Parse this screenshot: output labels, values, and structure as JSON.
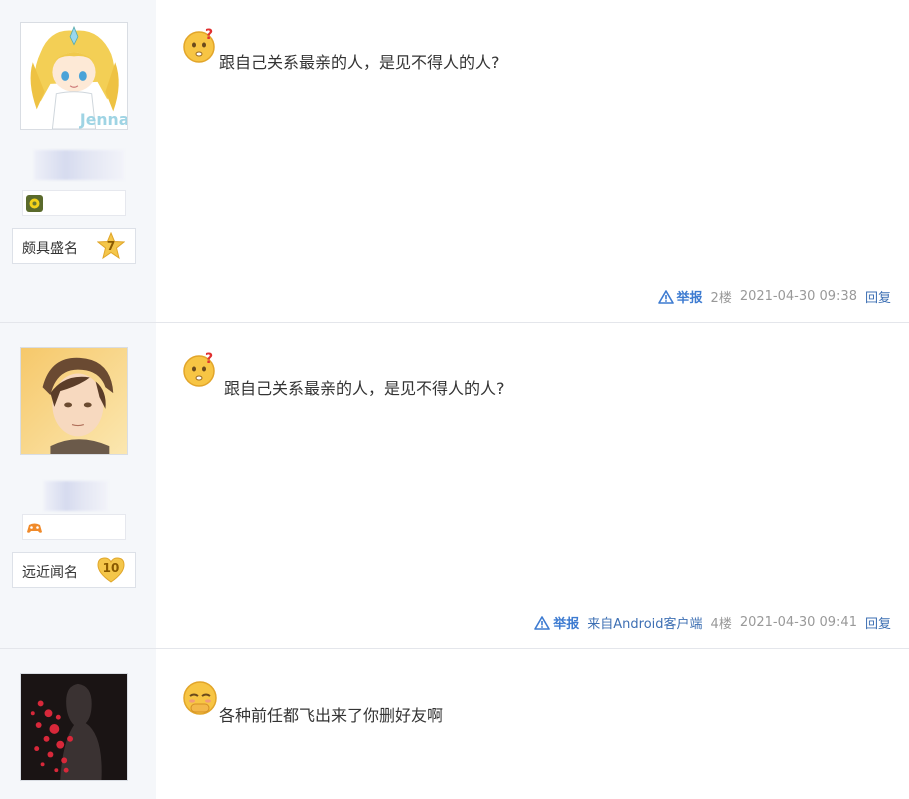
{
  "posts": [
    {
      "level_title": "颇具盛名",
      "level_number": "7",
      "content": "跟自己关系最亲的人，是见不得人的人?",
      "report_label": "举报",
      "client_text": "",
      "floor": "2楼",
      "timestamp": "2021-04-30 09:38",
      "reply_label": "回复"
    },
    {
      "level_title": "远近闻名",
      "level_number": "10",
      "content": "跟自己关系最亲的人，是见不得人的人?",
      "report_label": "举报",
      "client_text": "来自Android客户端",
      "floor": "4楼",
      "timestamp": "2021-04-30 09:41",
      "reply_label": "回复"
    },
    {
      "content": "各种前任都飞出来了你删好友啊"
    }
  ],
  "colors": {
    "link_blue": "#3d6fb3",
    "report_blue": "#3d7bd1",
    "meta_gray": "#999999",
    "sidebar_bg": "#f5f7fa"
  },
  "icons": {
    "report": "warning-triangle-icon",
    "emoji_1": "confused-face-emoji",
    "emoji_3": "shy-face-emoji"
  }
}
